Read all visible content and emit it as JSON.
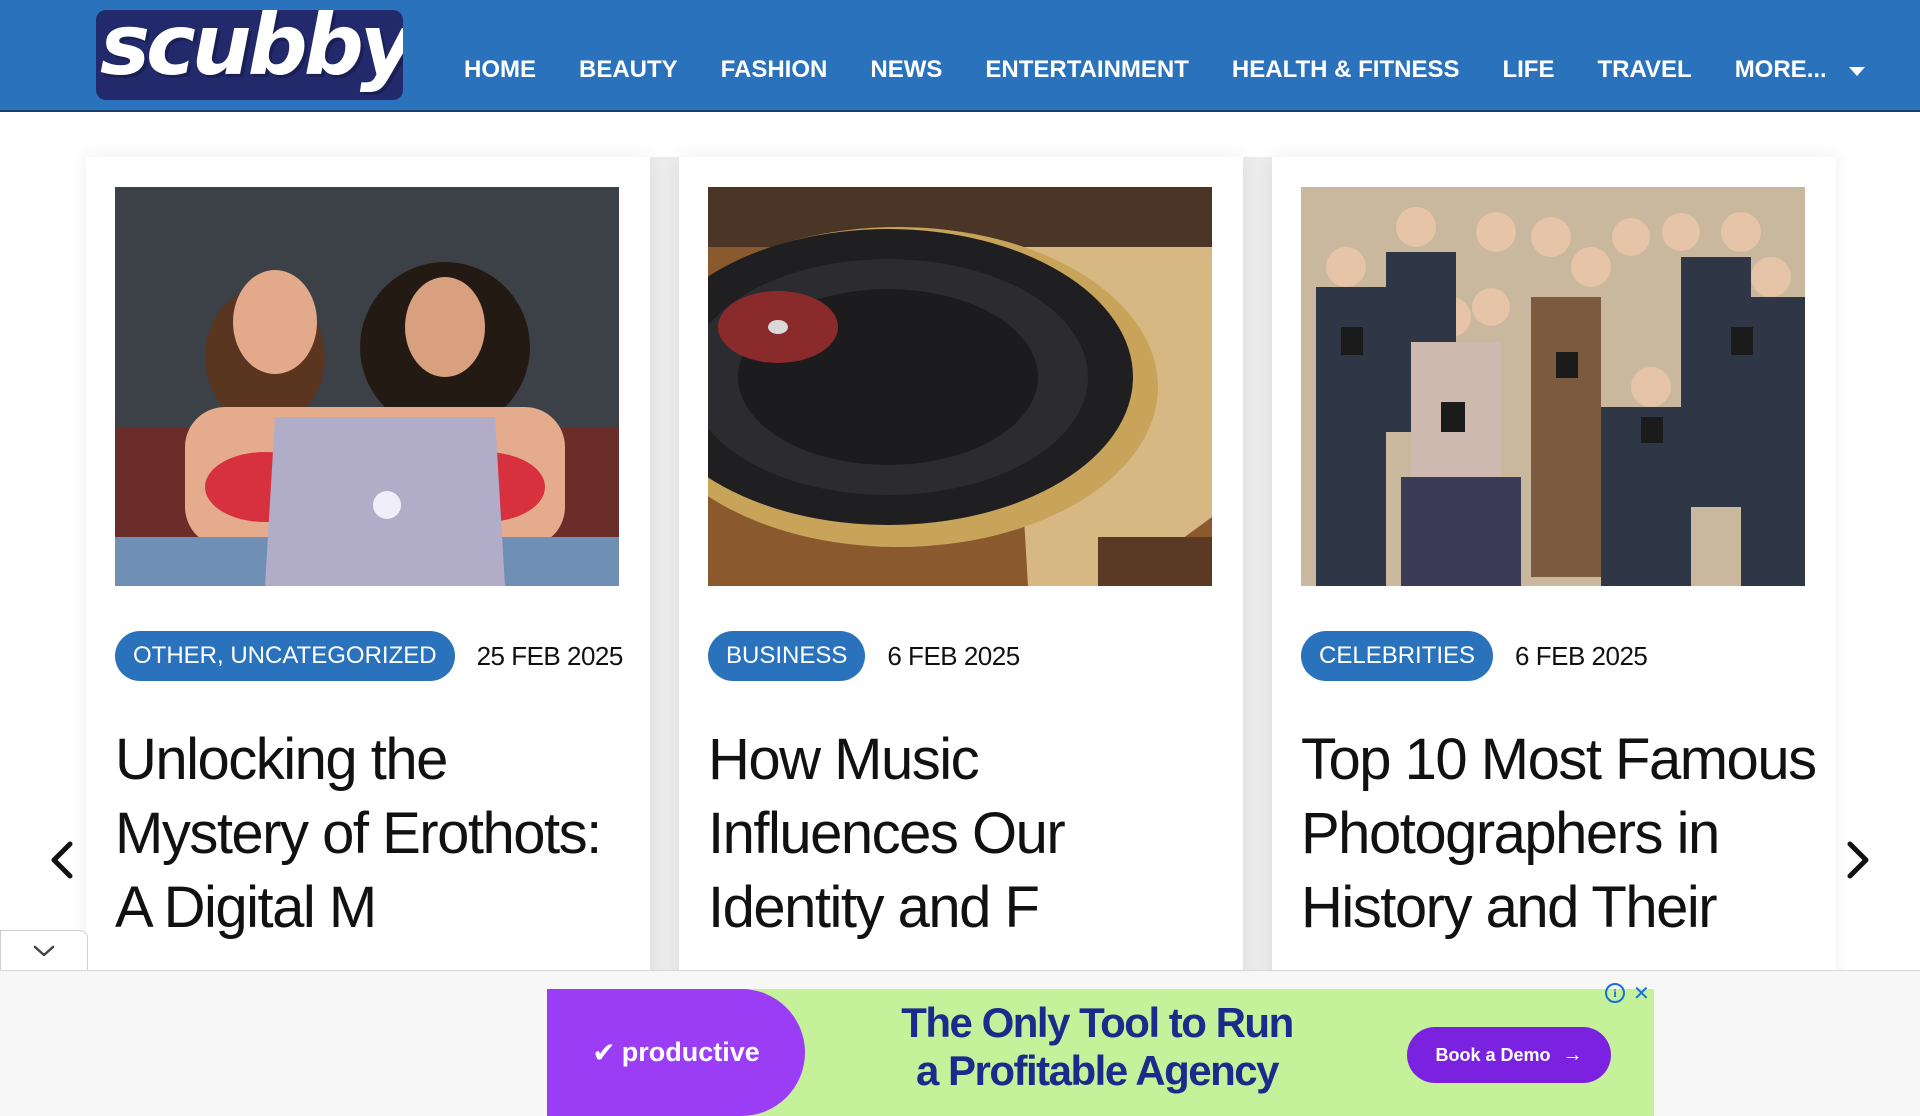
{
  "header": {
    "logo_text": "scubby",
    "nav": [
      {
        "label": "HOME"
      },
      {
        "label": "BEAUTY"
      },
      {
        "label": "FASHION"
      },
      {
        "label": "NEWS"
      },
      {
        "label": "ENTERTAINMENT"
      },
      {
        "label": "HEALTH & FITNESS"
      },
      {
        "label": "LIFE"
      },
      {
        "label": "TRAVEL"
      }
    ],
    "more_label": "MORE...",
    "bg_color": "#2b72bd"
  },
  "cards": [
    {
      "category": "OTHER, UNCATEGORIZED",
      "date": "25 FEB 2025",
      "title": "Unlocking the Mystery of Erothots: A Digital M",
      "image": "photo-two-women-laptop"
    },
    {
      "category": "BUSINESS",
      "date": "6 FEB 2025",
      "title": "How Music Influences Our Identity and F",
      "image": "photo-vinyl-record-turntable"
    },
    {
      "category": "CELEBRITIES",
      "date": "6 FEB 2025",
      "title": "Top 10 Most Famous Photographers in History and Their",
      "image": "photo-group-photographers-cameras"
    }
  ],
  "carousel": {
    "prev_icon": "chevron-left-icon",
    "next_icon": "chevron-right-icon"
  },
  "ad": {
    "brand": "productive",
    "headline_line1": "The Only Tool to Run",
    "headline_line2": "a Profitable Agency",
    "cta_label": "Book a Demo",
    "accent_color": "#9b3df5",
    "bg_color": "#c4f19a"
  }
}
